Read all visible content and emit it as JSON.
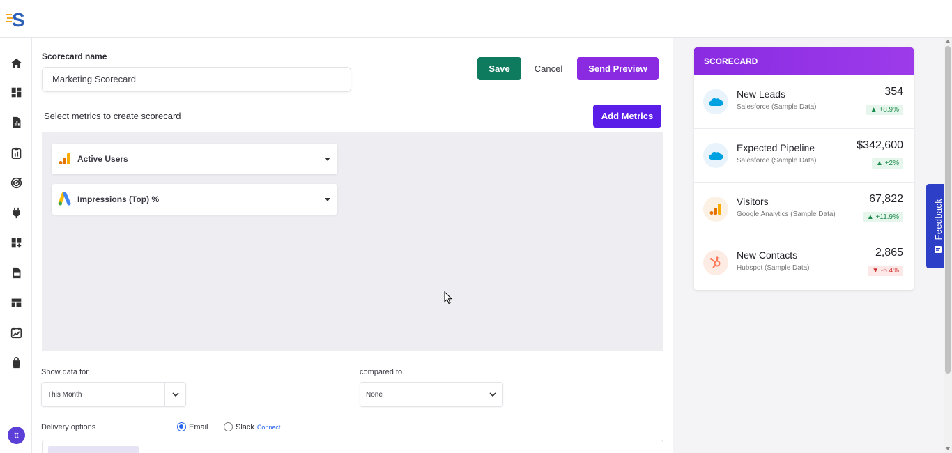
{
  "app": {
    "logo_letter": "S",
    "brand_color": "#2b5fb8",
    "accent_color": "#8a2be2"
  },
  "sidebar": {
    "items": [
      {
        "name": "home-icon"
      },
      {
        "name": "dashboard-icon"
      },
      {
        "name": "report-icon"
      },
      {
        "name": "clipboard-chart-icon"
      },
      {
        "name": "goal-target-icon"
      },
      {
        "name": "plug-icon"
      },
      {
        "name": "add-widget-icon"
      },
      {
        "name": "csv-file-icon"
      },
      {
        "name": "layout-icon"
      },
      {
        "name": "calendar-chart-icon"
      },
      {
        "name": "shopping-bag-icon"
      }
    ],
    "avatar_initials": "tt"
  },
  "editor": {
    "scorecard_name_label": "Scorecard name",
    "scorecard_name_value": "Marketing Scorecard",
    "save_label": "Save",
    "cancel_label": "Cancel",
    "send_preview_label": "Send Preview",
    "select_metrics_label": "Select metrics to create scorecard",
    "add_metrics_label": "Add Metrics",
    "metrics": [
      {
        "label": "Active Users",
        "icon": "google-analytics-icon"
      },
      {
        "label": "Impressions (Top) %",
        "icon": "google-ads-icon"
      }
    ],
    "show_data_for_label": "Show data for",
    "show_data_for_value": "This Month",
    "compared_to_label": "compared to",
    "compared_to_value": "None",
    "delivery_options_label": "Delivery options",
    "delivery_email_label": "Email",
    "delivery_slack_label": "Slack",
    "delivery_slack_connect": "Connect",
    "delivery_selected": "Email"
  },
  "preview": {
    "header": "SCORECARD",
    "cards": [
      {
        "title": "New Leads",
        "source": "Salesforce (Sample Data)",
        "value": "354",
        "change": "▲ +8.9%",
        "direction": "up",
        "icon": "salesforce-icon"
      },
      {
        "title": "Expected Pipeline",
        "source": "Salesforce (Sample Data)",
        "value": "$342,600",
        "change": "▲ +2%",
        "direction": "up",
        "icon": "salesforce-icon"
      },
      {
        "title": "Visitors",
        "source": "Google Analytics (Sample Data)",
        "value": "67,822",
        "change": "▲ +11.9%",
        "direction": "up",
        "icon": "google-analytics-icon"
      },
      {
        "title": "New Contacts",
        "source": "Hubspot (Sample Data)",
        "value": "2,865",
        "change": "▼ -6.4%",
        "direction": "down",
        "icon": "hubspot-icon"
      }
    ]
  },
  "feedback": {
    "label": "Feedback"
  }
}
